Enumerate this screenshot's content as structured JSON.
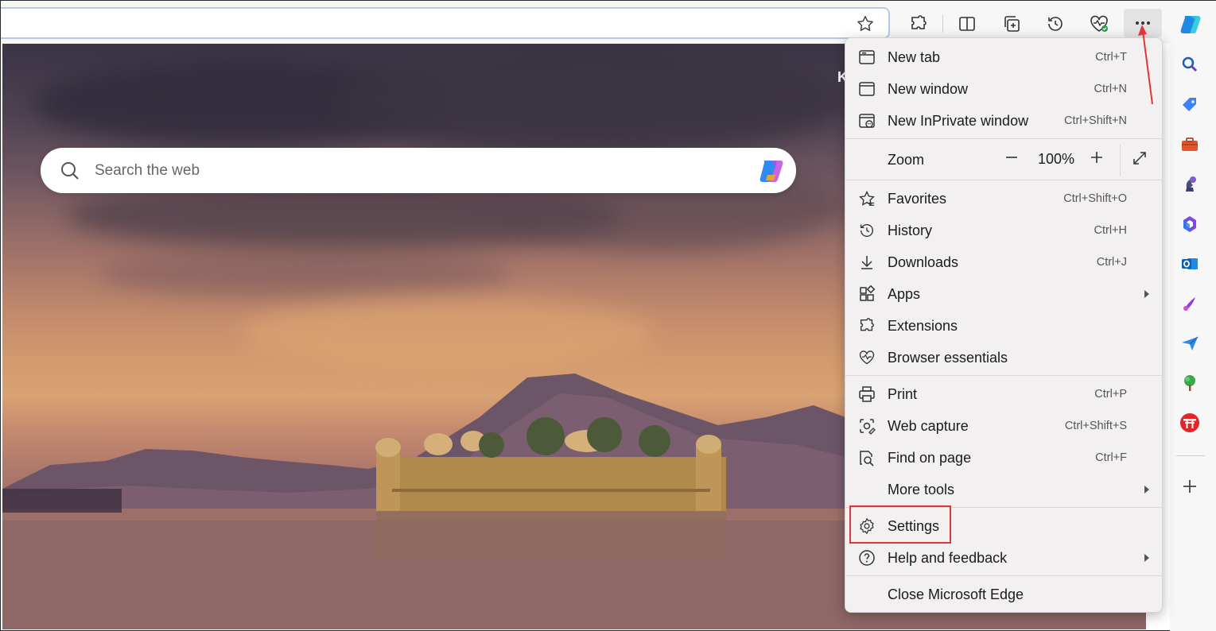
{
  "address_bar": {
    "value": ""
  },
  "search": {
    "placeholder": "Search the web"
  },
  "partial_text": "K",
  "menu": {
    "new_tab": {
      "label": "New tab",
      "shortcut": "Ctrl+T"
    },
    "new_window": {
      "label": "New window",
      "shortcut": "Ctrl+N"
    },
    "new_inprivate": {
      "label": "New InPrivate window",
      "shortcut": "Ctrl+Shift+N"
    },
    "zoom": {
      "label": "Zoom",
      "minus": "—",
      "value": "100%",
      "plus": "+"
    },
    "favorites": {
      "label": "Favorites",
      "shortcut": "Ctrl+Shift+O"
    },
    "history": {
      "label": "History",
      "shortcut": "Ctrl+H"
    },
    "downloads": {
      "label": "Downloads",
      "shortcut": "Ctrl+J"
    },
    "apps": {
      "label": "Apps"
    },
    "extensions": {
      "label": "Extensions"
    },
    "browser_essentials": {
      "label": "Browser essentials"
    },
    "print": {
      "label": "Print",
      "shortcut": "Ctrl+P"
    },
    "web_capture": {
      "label": "Web capture",
      "shortcut": "Ctrl+Shift+S"
    },
    "find_on_page": {
      "label": "Find on page",
      "shortcut": "Ctrl+F"
    },
    "more_tools": {
      "label": "More tools"
    },
    "settings": {
      "label": "Settings"
    },
    "help_feedback": {
      "label": "Help and feedback"
    },
    "close_edge": {
      "label": "Close Microsoft Edge"
    }
  },
  "colors": {
    "highlight": "#e0363a",
    "copilot_blue": "#1a73e8",
    "menu_bg": "#f3f0f2"
  },
  "icons": {
    "toolbar": [
      "star-icon",
      "extensions-icon",
      "split-screen-icon",
      "collections-icon",
      "history-icon",
      "browser-essentials-icon",
      "more-icon"
    ],
    "sidebar": [
      "copilot-icon",
      "search-icon",
      "shopping-tag-icon",
      "tools-icon",
      "games-icon",
      "microsoft365-icon",
      "outlook-icon",
      "designer-icon",
      "drop-icon",
      "tree-icon",
      "shrine-icon",
      "add-icon"
    ]
  }
}
